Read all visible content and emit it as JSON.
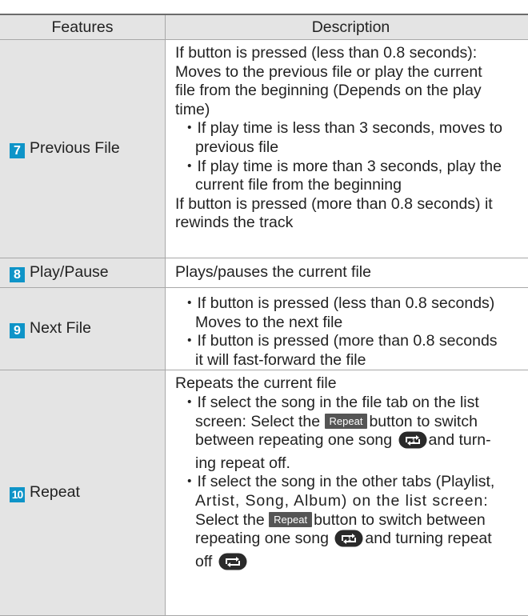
{
  "header": {
    "features": "Features",
    "description": "Description"
  },
  "rows": {
    "previous": {
      "number": "7",
      "label": "Previous File",
      "lines": [
        "If button is pressed (less than 0.8 seconds):",
        "Moves to the previous file or play the current",
        "file from the beginning (Depends on the play",
        "time)",
        "・If play time is less than 3 seconds, moves to",
        "previous file",
        "・If play time is more than 3 seconds, play the",
        "current file from the beginning",
        "If button is pressed (more than 0.8 seconds) it",
        "rewinds the track"
      ]
    },
    "play": {
      "number": "8",
      "label": "Play/Pause",
      "lines": [
        "Plays/pauses the current file"
      ]
    },
    "next": {
      "number": "9",
      "label": "Next File",
      "lines": [
        "・If button is pressed (less than 0.8 seconds)",
        "Moves to the next file",
        "・If button is pressed (more than 0.8 seconds",
        "it will fast-forward the file"
      ]
    },
    "repeat": {
      "number": "10",
      "label": "Repeat",
      "button_label": "Repeat",
      "text": {
        "l1": "Repeats the current file",
        "l2": "・If select the song in the file tab on the list",
        "l3a": "screen: Select the",
        "l3b": "button to switch",
        "l4a": "between repeating one song",
        "l4b": "and turn-",
        "l5": "ing repeat off.",
        "l6": "・If select the song in the other tabs (Playlist,",
        "l7": "Artist, Song, Album) on the list screen:",
        "l8a": "Select the",
        "l8b": "button to switch between",
        "l9a": "repeating one song",
        "l9b": "and turning repeat",
        "l10": "off"
      }
    }
  },
  "icons": {
    "repeat_one": "repeat-one-icon",
    "repeat_off": "repeat-off-icon"
  },
  "colors": {
    "number_badge": "#0e94c8",
    "header_bg": "#e4e4e4",
    "button_bg": "#555555"
  }
}
